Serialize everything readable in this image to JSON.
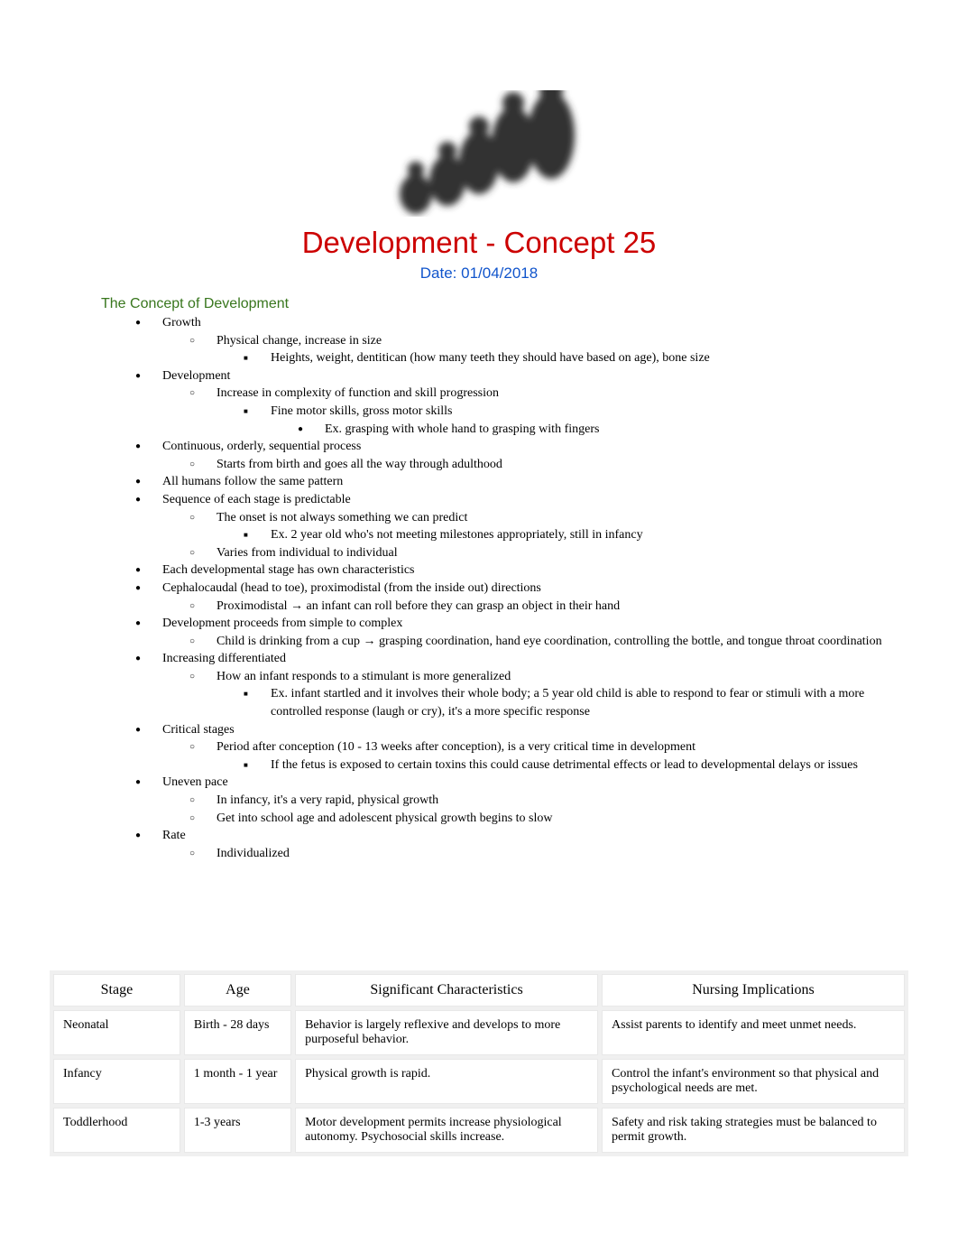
{
  "title": "Development - Concept 25",
  "date": "Date: 01/04/2018",
  "section_heading": "The Concept of Development",
  "bullets": {
    "growth": {
      "label": "Growth",
      "sub1": "Physical change, increase in size",
      "sub2": "Heights, weight, dentitican (how many teeth they should have based on age), bone size"
    },
    "development": {
      "label": "Development",
      "sub1": "Increase in complexity of function and skill progression",
      "sub2": "Fine motor skills, gross motor skills",
      "sub3": "Ex. grasping with whole hand to grasping with fingers"
    },
    "continuous": {
      "label": "Continuous, orderly, sequential process",
      "sub1": "Starts from birth and goes all the way through adulthood"
    },
    "all_humans": "All humans follow the same pattern",
    "sequence": {
      "label": "Sequence of each stage is predictable",
      "sub1": "The onset is not always something we can predict",
      "sub2": "Ex. 2 year old who's not meeting milestones appropriately, still in infancy",
      "sub3": "Varies from individual to individual"
    },
    "each_stage": "Each developmental stage has own characteristics",
    "cephalo": {
      "label": "Cephalocaudal (head to toe), proximodistal (from the inside out) directions",
      "sub1": "Proximodistal → an infant can roll before they can grasp an object in their hand"
    },
    "simple_complex": {
      "label": "Development proceeds from simple to complex",
      "sub1": "Child is drinking from a cup → grasping coordination, hand eye coordination, controlling the bottle, and tongue throat coordination"
    },
    "increasing_diff": {
      "label": "Increasing differentiated",
      "sub1": "How an infant responds to a stimulant is more generalized",
      "sub2": "Ex. infant startled and it involves their whole body; a 5 year old child is able to respond to fear or stimuli with a more controlled response (laugh or cry), it's a more specific response"
    },
    "critical": {
      "label": "Critical stages",
      "sub1": "Period after conception (10 - 13 weeks after conception), is a very critical time in development",
      "sub2": "If the fetus is exposed to certain toxins this could cause detrimental effects or lead to developmental delays or issues"
    },
    "uneven": {
      "label": "Uneven pace",
      "sub1": "In infancy, it's a very rapid, physical growth",
      "sub2": "Get into school age and adolescent physical growth begins to slow"
    },
    "rate": {
      "label": "Rate",
      "sub1": "Individualized"
    }
  },
  "table": {
    "headers": {
      "stage": "Stage",
      "age": "Age",
      "characteristics": "Significant Characteristics",
      "nursing": "Nursing Implications"
    },
    "rows": [
      {
        "stage": "Neonatal",
        "age": "Birth - 28 days",
        "characteristics": "Behavior is largely reflexive and develops to more purposeful behavior.",
        "nursing": "Assist parents to identify and meet unmet needs."
      },
      {
        "stage": "Infancy",
        "age": "1 month - 1 year",
        "characteristics": "Physical growth is rapid.",
        "nursing": "Control the infant's environment so that physical and psychological needs are met."
      },
      {
        "stage": "Toddlerhood",
        "age": "1-3 years",
        "characteristics": "Motor development permits increase physiological autonomy. Psychosocial skills increase.",
        "nursing": "Safety and risk taking strategies must be balanced to permit growth."
      }
    ]
  }
}
